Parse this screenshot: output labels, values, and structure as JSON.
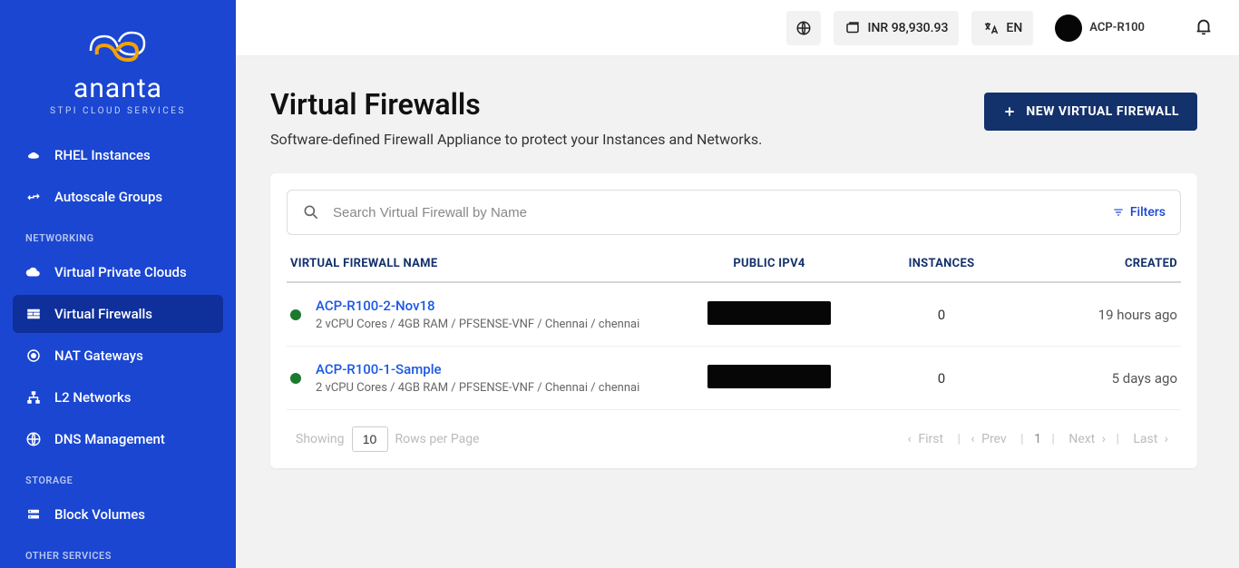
{
  "brand": {
    "name": "ananta",
    "tagline": "STPI CLOUD SERVICES"
  },
  "topbar": {
    "balance": "INR 98,930.93",
    "lang": "EN",
    "user": "ACP-R100"
  },
  "sidebar": {
    "sections": [
      {
        "title": null,
        "items": [
          {
            "icon": "rhel",
            "label": "RHEL Instances"
          },
          {
            "icon": "autoscale",
            "label": "Autoscale Groups"
          }
        ]
      },
      {
        "title": "NETWORKING",
        "items": [
          {
            "icon": "cloud",
            "label": "Virtual Private Clouds"
          },
          {
            "icon": "firewall",
            "label": "Virtual Firewalls",
            "active": true
          },
          {
            "icon": "nat",
            "label": "NAT Gateways"
          },
          {
            "icon": "l2",
            "label": "L2 Networks"
          },
          {
            "icon": "dns",
            "label": "DNS Management"
          }
        ]
      },
      {
        "title": "STORAGE",
        "items": [
          {
            "icon": "volume",
            "label": "Block Volumes"
          }
        ]
      },
      {
        "title": "OTHER SERVICES",
        "items": []
      }
    ]
  },
  "page": {
    "title": "Virtual Firewalls",
    "subtitle": "Software-defined Firewall Appliance to protect your Instances and Networks.",
    "cta": "NEW VIRTUAL FIREWALL"
  },
  "search": {
    "placeholder": "Search Virtual Firewall by Name",
    "filters_label": "Filters"
  },
  "table": {
    "columns": {
      "name": "VIRTUAL FIREWALL NAME",
      "ip": "PUBLIC IPV4",
      "instances": "INSTANCES",
      "created": "CREATED"
    },
    "rows": [
      {
        "status": "running",
        "name": "ACP-R100-2-Nov18",
        "spec": "2 vCPU Cores / 4GB RAM / PFSENSE-VNF / Chennai / chennai",
        "ip_masked": true,
        "instances": "0",
        "created": "19 hours ago"
      },
      {
        "status": "running",
        "name": "ACP-R100-1-Sample",
        "spec": "2 vCPU Cores / 4GB RAM / PFSENSE-VNF / Chennai / chennai",
        "ip_masked": true,
        "instances": "0",
        "created": "5 days ago"
      }
    ]
  },
  "pagination": {
    "showing_label": "Showing",
    "rows_value": "10",
    "rows_suffix": "Rows per Page",
    "first": "First",
    "prev": "Prev",
    "current": "1",
    "next": "Next",
    "last": "Last"
  }
}
